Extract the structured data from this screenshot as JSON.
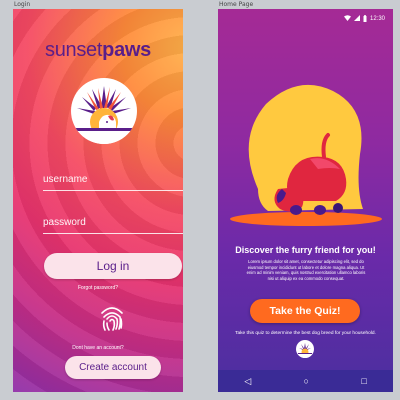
{
  "frames": {
    "login_label": "Login",
    "home_label": "Home Page"
  },
  "login": {
    "brand_part1": "sunset",
    "brand_part2": "paws",
    "username_placeholder": "username",
    "password_placeholder": "password",
    "login_button": "Log in",
    "forgot_password": "Forgot password?",
    "no_account": "Dont have an account?",
    "create_account_button": "Create account",
    "icons": [
      "sunset-paws-logo-icon",
      "fingerprint-icon"
    ]
  },
  "home": {
    "status_time": "12:30",
    "status_icons": [
      "wifi-icon",
      "signal-icon",
      "battery-icon"
    ],
    "title": "Discover the furry friend for you!",
    "lorem": "Lorem ipsum dolor sit amet, consectetur adipiscing elit, sed do eiusmod tempor incididunt ut labore et dolore magna aliqua. Ut enim ad minim veniam, quis nostrud exercitation ullamco laboris nisi ut aliquip ex ea commodo consequat.",
    "quiz_button": "Take the Quiz!",
    "quiz_description": "Take this quiz to determine the best dog breed for your household.",
    "nav": {
      "back": "◁",
      "home": "○",
      "recents": "□"
    }
  },
  "colors": {
    "brand_purple": "#5a1e8a",
    "quiz_orange": "#ff6a1f",
    "sun_yellow": "#ffc93f"
  }
}
